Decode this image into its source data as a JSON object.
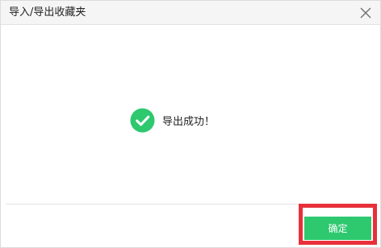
{
  "dialog": {
    "title": "导入/导出收藏夹",
    "close_icon": "close-icon",
    "message": "导出成功！",
    "success_icon": "check-circle-icon",
    "success_color": "#2ec86f",
    "ok_label": "确定",
    "ok_button_color": "#2ec86f",
    "highlight_color": "#e8303a"
  }
}
